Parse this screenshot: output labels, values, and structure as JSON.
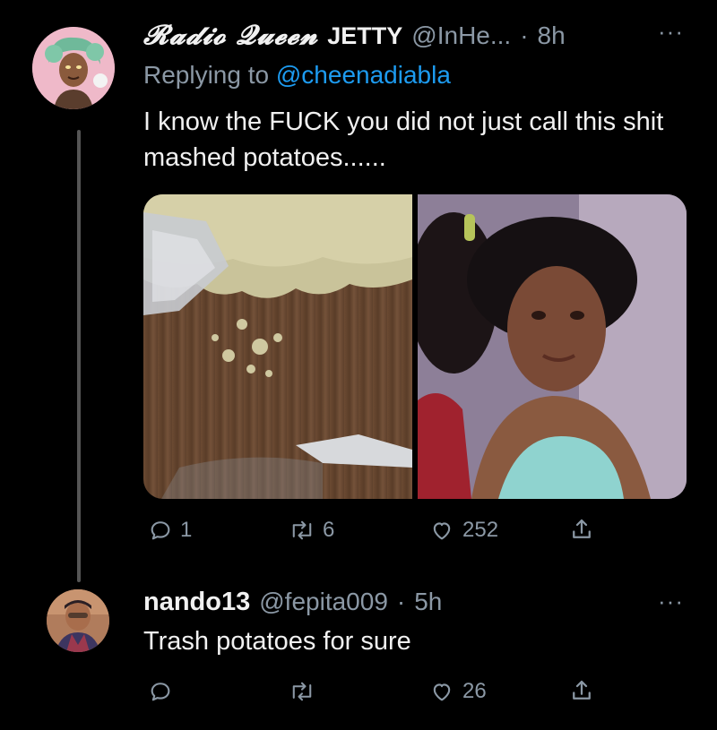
{
  "tweet": {
    "display_name": "𝓡𝓪𝓭𝓲𝓸 𝓠𝓾𝓮𝓮𝓷",
    "display_suffix": "JETTY",
    "handle": "@InHe...",
    "separator": "·",
    "time": "8h",
    "more": "···",
    "replying_prefix": "Replying to",
    "replying_to": "@cheenadiabla",
    "text": "I know the FUCK you did not just call this shit mashed potatoes......",
    "reply_count": "1",
    "retweet_count": "6",
    "like_count": "252"
  },
  "reply": {
    "name": "nando13",
    "handle": "@fepita009",
    "separator": "·",
    "time": "5h",
    "more": "···",
    "text": "Trash potatoes for sure",
    "like_count": "26"
  },
  "icons": {
    "reply": "reply-icon",
    "retweet": "retweet-icon",
    "like": "heart-icon",
    "share": "share-icon"
  },
  "colors": {
    "background": "#000000",
    "text": "#f1f1f1",
    "muted": "#8b98a5",
    "mention": "#1d9bf0"
  }
}
